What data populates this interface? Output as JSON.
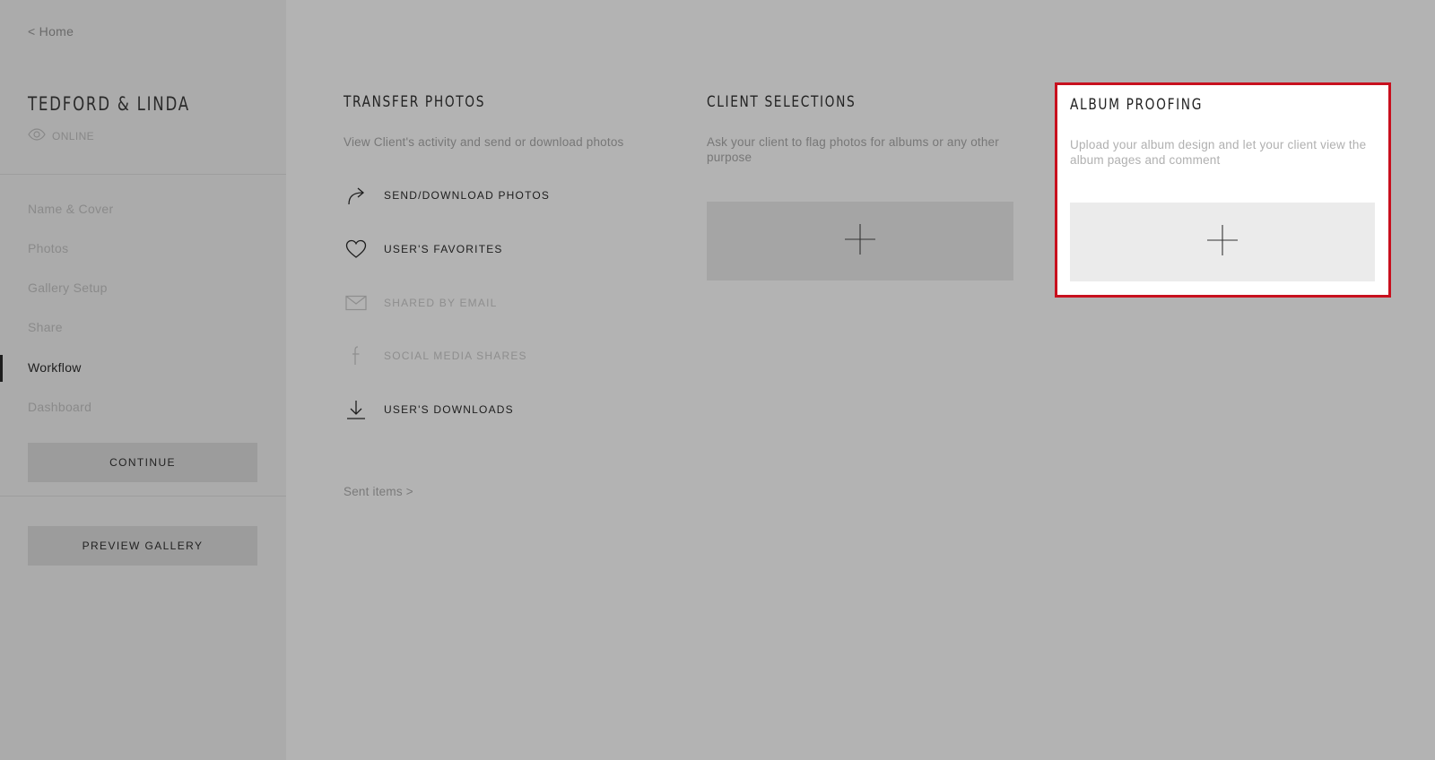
{
  "sidebar": {
    "home_link": "< Home",
    "gallery_title": "TEDFORD & LINDA",
    "status": {
      "icon": "eye-icon",
      "label": "ONLINE"
    },
    "nav": [
      {
        "label": "Name & Cover",
        "active": false
      },
      {
        "label": "Photos",
        "active": false
      },
      {
        "label": "Gallery Setup",
        "active": false
      },
      {
        "label": "Share",
        "active": false
      },
      {
        "label": "Workflow",
        "active": true
      },
      {
        "label": "Dashboard",
        "active": false
      }
    ],
    "continue_label": "CONTINUE",
    "preview_label": "PREVIEW GALLERY"
  },
  "transfer": {
    "title": "TRANSFER PHOTOS",
    "description": "View Client's activity and send or download photos",
    "actions": [
      {
        "icon": "share-arrow-icon",
        "label": "SEND/DOWNLOAD PHOTOS",
        "enabled": true
      },
      {
        "icon": "heart-icon",
        "label": "USER'S FAVORITES",
        "enabled": true
      },
      {
        "icon": "envelope-icon",
        "label": "SHARED BY EMAIL",
        "enabled": false
      },
      {
        "icon": "facebook-icon",
        "label": "SOCIAL MEDIA SHARES",
        "enabled": false
      },
      {
        "icon": "download-icon",
        "label": "USER'S DOWNLOADS",
        "enabled": true
      }
    ],
    "sent_items": "Sent items >"
  },
  "client_selections": {
    "title": "CLIENT SELECTIONS",
    "description": "Ask your client to flag photos for albums or any other purpose",
    "add_icon": "plus-icon"
  },
  "album_proofing": {
    "title": "ALBUM PROOFING",
    "description": "Upload your album design and let your client view the album pages and comment",
    "add_icon": "plus-icon",
    "highlight_color": "#c8101e"
  }
}
